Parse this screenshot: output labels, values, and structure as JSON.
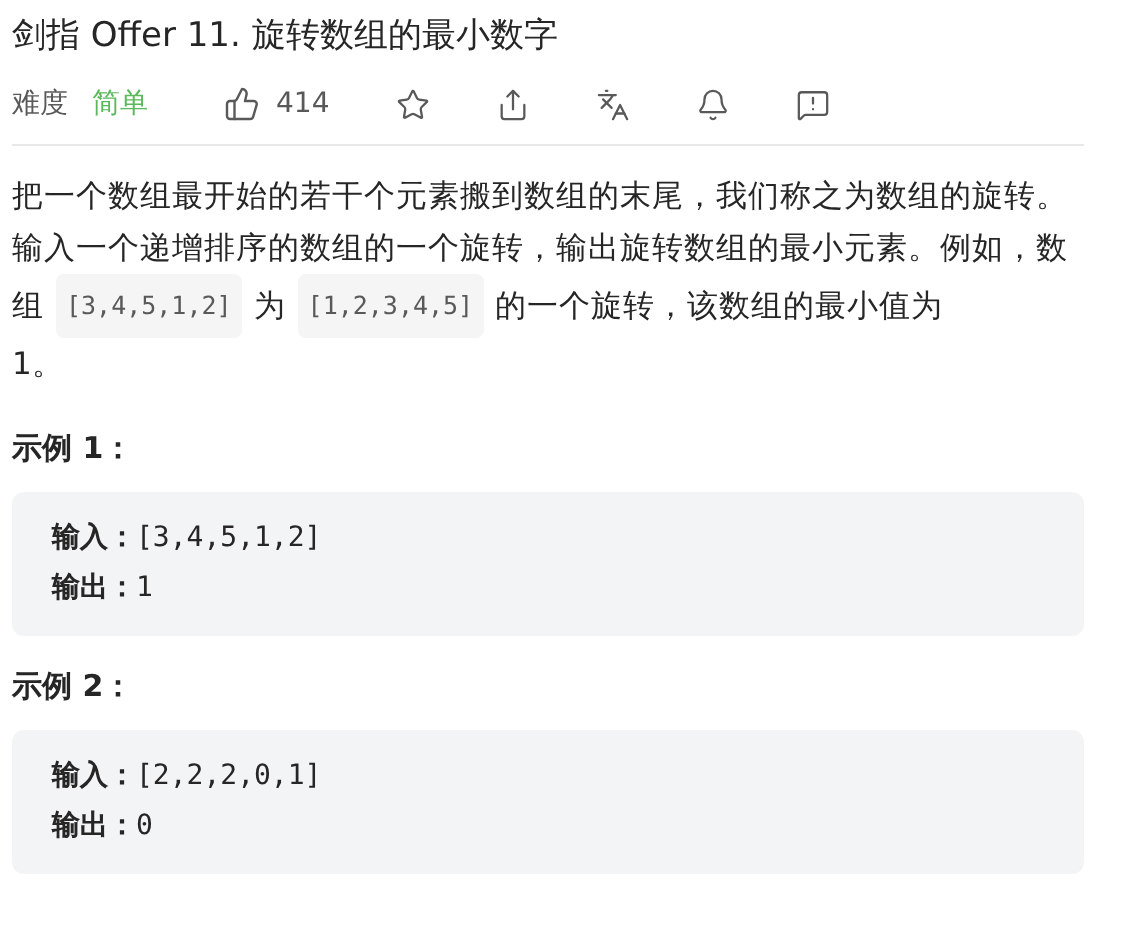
{
  "title": "剑指 Offer 11. 旋转数组的最小数字",
  "meta": {
    "difficulty_label": "难度",
    "difficulty": "简单",
    "likes": "414"
  },
  "description": [
    [
      {
        "kind": "text",
        "text": "把一个数组最开始的若干个元素搬到数组的末尾，我们称之为数组的旋转。"
      }
    ],
    [
      {
        "kind": "text",
        "text": "输入一个递增排序的数组的一个旋转，输出旋转数组的最小元素。例如，数"
      }
    ],
    [
      {
        "kind": "text",
        "text": "组"
      },
      {
        "kind": "code",
        "text": "[3,4,5,1,2]"
      },
      {
        "kind": "text",
        "text": "为"
      },
      {
        "kind": "code",
        "text": "[1,2,3,4,5]"
      },
      {
        "kind": "text",
        "text": "的一个旋转，该数组的最小值为"
      }
    ],
    [
      {
        "kind": "text",
        "text": "1。"
      }
    ]
  ],
  "examples": [
    {
      "heading": "示例 1：",
      "lines": [
        "**输入：**[3,4,5,1,2]",
        "**输出：**1"
      ]
    },
    {
      "heading": "示例 2：",
      "lines": [
        "**输入：**[2,2,2,0,1]",
        "**输出：**0"
      ]
    }
  ]
}
